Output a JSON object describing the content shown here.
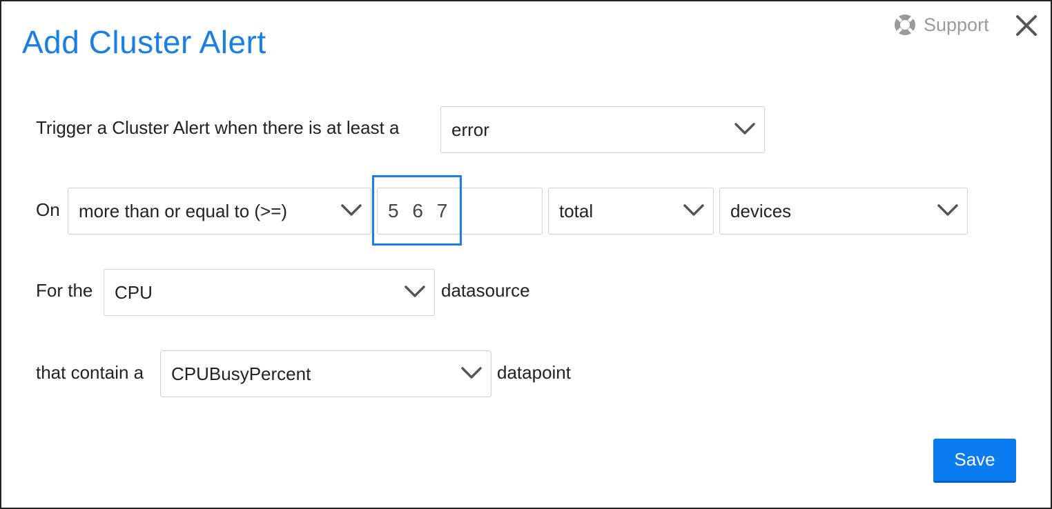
{
  "dialog": {
    "title": "Add Cluster Alert",
    "support_label": "Support",
    "icons": {
      "support": "lifebuoy-icon",
      "close": "close-icon",
      "dropdown": "chevron-down-icon"
    }
  },
  "form": {
    "row1": {
      "prefix": "Trigger a Cluster Alert when there is at least a",
      "severity": "error"
    },
    "row2": {
      "prefix": "On",
      "comparison": "more than or equal to (>=)",
      "threshold": "5 6 7",
      "scope": "total",
      "unit": "devices"
    },
    "row3": {
      "prefix": "For the",
      "datasource": "CPU",
      "suffix": "datasource"
    },
    "row4": {
      "prefix": "that contain a",
      "datapoint": "CPUBusyPercent",
      "suffix": "datapoint"
    }
  },
  "actions": {
    "save_label": "Save"
  },
  "colors": {
    "accent": "#1a7fe0",
    "button": "#0a7cf0",
    "border": "#cfcfcf",
    "muted": "#9a9a9a"
  }
}
